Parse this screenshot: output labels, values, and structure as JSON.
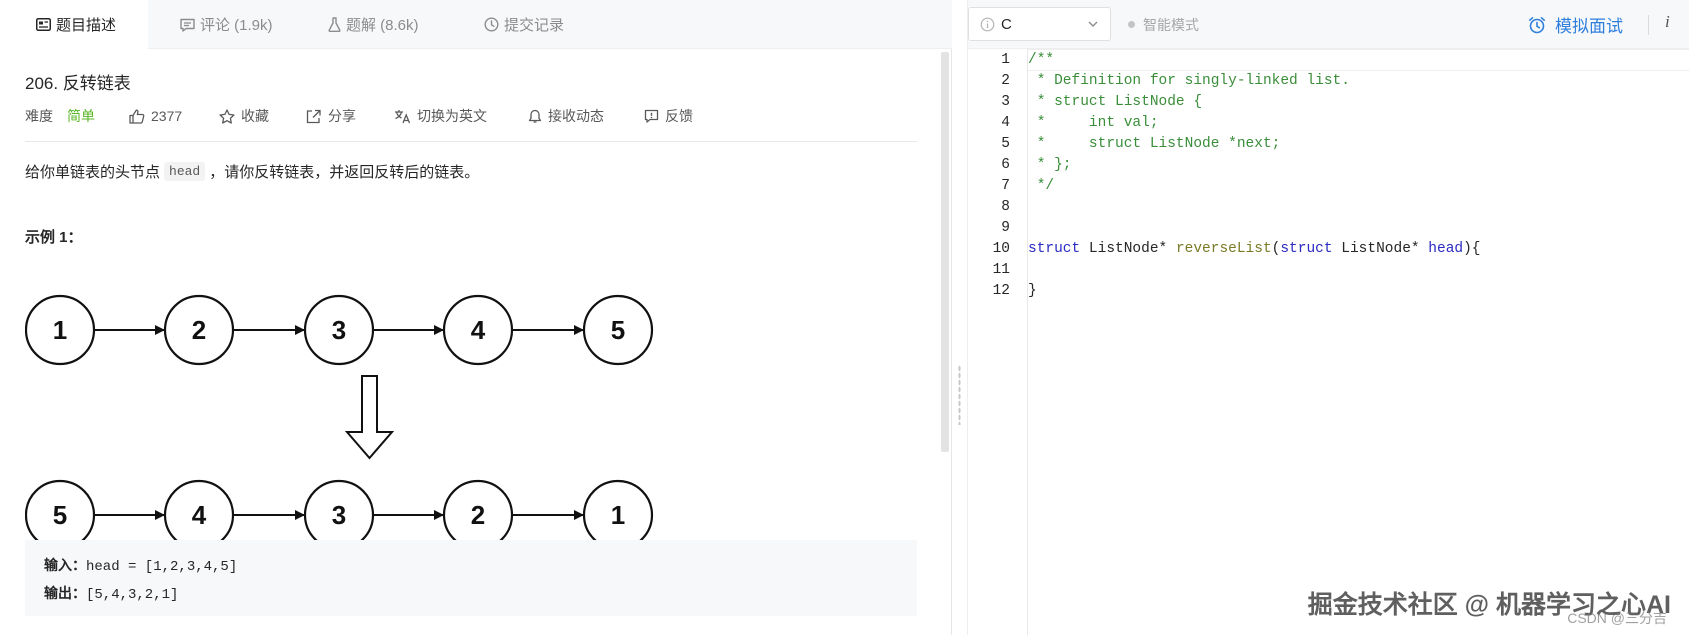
{
  "tabs": [
    {
      "label": "题目描述",
      "icon": "description-icon"
    },
    {
      "label": "评论 (1.9k)",
      "icon": "comment-icon"
    },
    {
      "label": "题解 (8.6k)",
      "icon": "solution-flask-icon"
    },
    {
      "label": "提交记录",
      "icon": "history-clock-icon"
    }
  ],
  "problem": {
    "title": "206. 反转链表",
    "difficulty_label": "难度",
    "difficulty_value": "简单",
    "difficulty_color": "#5ab726",
    "likes": "2377",
    "favorite_label": "收藏",
    "share_label": "分享",
    "switch_lang_label": "切换为英文",
    "notify_label": "接收动态",
    "feedback_label": "反馈",
    "desc_before": "给你单链表的头节点",
    "desc_code": "head",
    "desc_after": "，请你反转链表，并返回反转后的链表。",
    "example_title": "示例 1：",
    "diagram": {
      "row1": [
        "1",
        "2",
        "3",
        "4",
        "5"
      ],
      "row2": [
        "5",
        "4",
        "3",
        "2",
        "1"
      ]
    },
    "input_label": "输入：",
    "input_value": "head = [1,2,3,4,5]",
    "output_label": "输出：",
    "output_value": "[5,4,3,2,1]"
  },
  "editor": {
    "language": "C",
    "smart_mode_label": "智能模式",
    "mock_interview_label": "模拟面试",
    "info_label": "i",
    "line_numbers": [
      "1",
      "2",
      "3",
      "4",
      "5",
      "6",
      "7",
      "8",
      "9",
      "10",
      "11",
      "12"
    ],
    "lines": {
      "l1": "/**",
      "l2": " * Definition for singly-linked list.",
      "l3": " * struct ListNode {",
      "l4": " *     int val;",
      "l5": " *     struct ListNode *next;",
      "l6": " * };",
      "l7": " */",
      "l10_kw1": "struct",
      "l10_t1": " ListNode* ",
      "l10_fn": "reverseList",
      "l10_t2": "(",
      "l10_kw2": "struct",
      "l10_t3": " ListNode* ",
      "l10_param": "head",
      "l10_t4": "){",
      "l12": "}"
    }
  },
  "watermark": "掘金技术社区 @ 机器学习之心AI",
  "watermark_sub": "CSDN @三分吉",
  "colors": {
    "accent": "#2f7fdd",
    "comment": "#3a8e3a",
    "keyword": "#2a2ac2",
    "function": "#7a7a24"
  }
}
